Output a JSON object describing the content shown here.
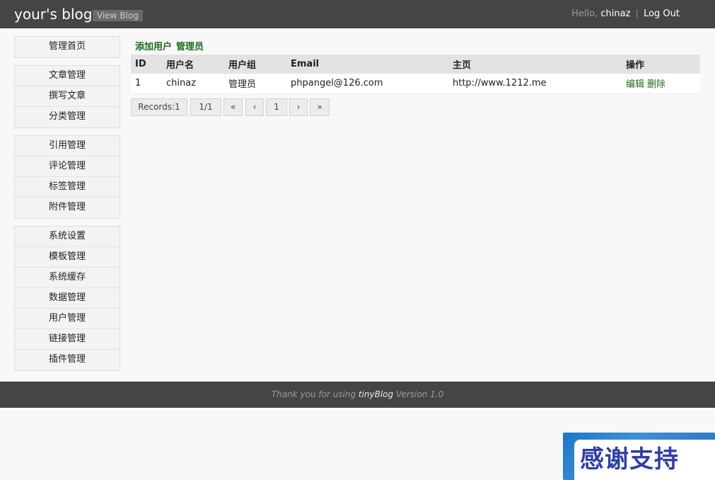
{
  "header": {
    "brand": "your's blog",
    "view_blog": "View Blog",
    "hello": "Hello,",
    "username": "chinaz",
    "separator": "|",
    "logout": "Log Out"
  },
  "sidebar": {
    "groups": [
      [
        "管理首页"
      ],
      [
        "文章管理",
        "撰写文章",
        "分类管理"
      ],
      [
        "引用管理",
        "评论管理",
        "标签管理",
        "附件管理"
      ],
      [
        "系统设置",
        "模板管理",
        "系统缓存",
        "数据管理",
        "用户管理",
        "链接管理",
        "插件管理"
      ]
    ]
  },
  "main": {
    "actions": [
      "添加用户",
      "管理员"
    ],
    "table": {
      "headers": [
        "ID",
        "用户名",
        "用户组",
        "Email",
        "主页",
        "操作"
      ],
      "rows": [
        {
          "id": "1",
          "username": "chinaz",
          "group": "管理员",
          "email": "phpangel@126.com",
          "homepage": "http://www.1212.me",
          "ops": [
            "编辑",
            "删除"
          ]
        }
      ]
    },
    "pager": {
      "records": "Records:1",
      "pages": "1/1",
      "first": "«",
      "prev": "‹",
      "current": "1",
      "next": "›",
      "last": "»"
    }
  },
  "footer": {
    "pre": "Thank you for using ",
    "name": "tinyBlog",
    "post": " Version 1.0"
  },
  "overlay": {
    "thanks": "感谢支持"
  }
}
